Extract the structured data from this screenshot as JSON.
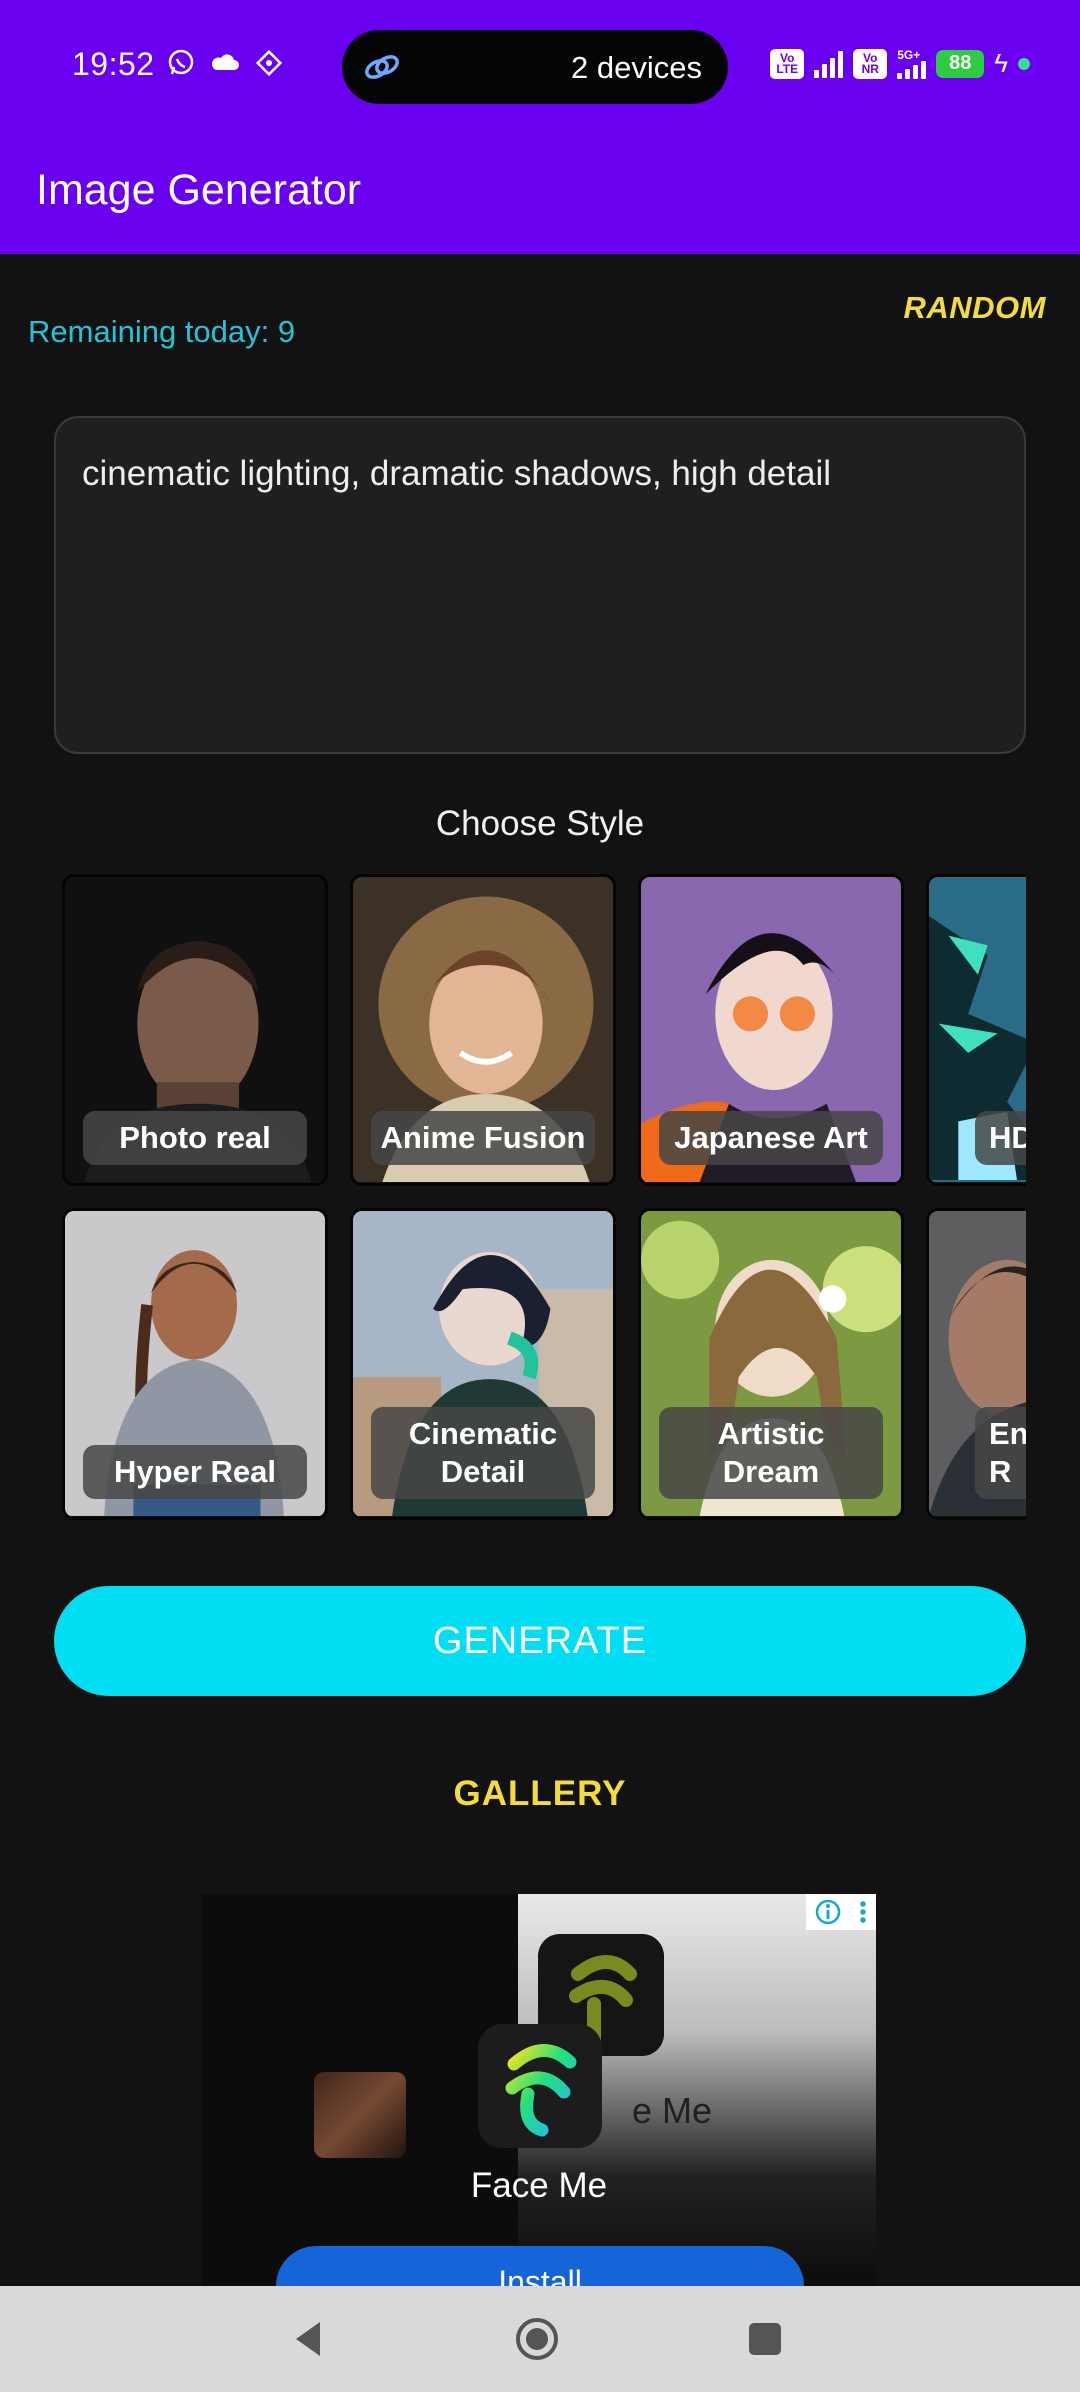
{
  "status_bar": {
    "time": "19:52",
    "left_icons": [
      "whatsapp-icon",
      "cloud-icon",
      "diamond-icon"
    ],
    "connection_pill": {
      "icon": "link-icon",
      "text": "2 devices"
    },
    "volte_badge": "Vo LTE",
    "vonr_badge": "Vo NR",
    "network_type": "5G+",
    "battery_level": "88",
    "charging": true
  },
  "app_bar": {
    "title": "Image Generator"
  },
  "quota": {
    "remaining_text": "Remaining today: 9"
  },
  "random_button": "RANDOM",
  "prompt": {
    "value": "cinematic lighting, dramatic shadows, high detail"
  },
  "style_section": {
    "heading": "Choose Style",
    "rows": [
      [
        {
          "label": "Photo real"
        },
        {
          "label": "Anime Fusion"
        },
        {
          "label": "Japanese Art"
        },
        {
          "label": "HD"
        }
      ],
      [
        {
          "label": "Hyper Real"
        },
        {
          "label": "Cinematic\nDetail"
        },
        {
          "label": "Artistic\nDream"
        },
        {
          "label": "En\nR"
        }
      ]
    ]
  },
  "generate_button": "GENERATE",
  "gallery_link": "GALLERY",
  "ad": {
    "app_name": "Face Me",
    "background_text": "e Me",
    "install_button": "Install"
  },
  "colors": {
    "primary": "#6a00f0",
    "accent_cyan": "#00def3",
    "accent_yellow": "#f3dc3e",
    "remaining_text": "#27c2d6",
    "background": "#121212",
    "install_blue": "#1565d8"
  }
}
